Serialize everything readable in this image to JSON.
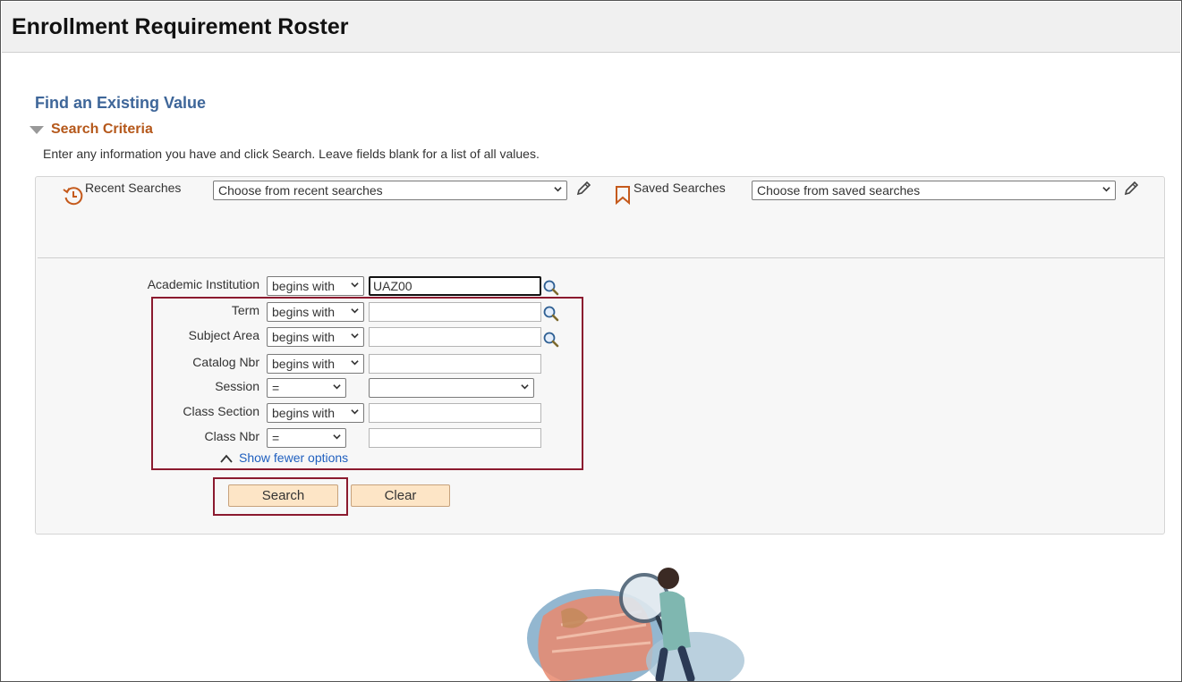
{
  "page": {
    "title": "Enrollment Requirement Roster"
  },
  "find": {
    "heading": "Find an Existing Value",
    "criteria_title": "Search Criteria",
    "instructions": "Enter any information you have and click Search. Leave fields blank for a list of all values."
  },
  "recent": {
    "label": "Recent Searches",
    "placeholder": "Choose from recent searches"
  },
  "saved": {
    "label": "Saved Searches",
    "placeholder": "Choose from saved searches"
  },
  "fields": {
    "academic_institution": {
      "label": "Academic Institution",
      "operator": "begins with",
      "value": "UAZ00"
    },
    "term": {
      "label": "Term",
      "operator": "begins with",
      "value": ""
    },
    "subject_area": {
      "label": "Subject Area",
      "operator": "begins with",
      "value": ""
    },
    "catalog_nbr": {
      "label": "Catalog Nbr",
      "operator": "begins with",
      "value": ""
    },
    "session": {
      "label": "Session",
      "operator": "=",
      "value": ""
    },
    "class_section": {
      "label": "Class Section",
      "operator": "begins with",
      "value": ""
    },
    "class_nbr": {
      "label": "Class Nbr",
      "operator": "=",
      "value": ""
    }
  },
  "show_fewer": "Show fewer options",
  "buttons": {
    "search": "Search",
    "clear": "Clear"
  },
  "colors": {
    "heading_blue": "#3e6699",
    "criteria_orange": "#b5581b",
    "link_blue": "#1f5fbf",
    "button_fill": "#fde5c6",
    "highlight": "#8b1a2f"
  },
  "icons": {
    "history": "history-icon",
    "bookmark": "bookmark-icon",
    "edit": "pencil-icon",
    "lookup": "magnifier-icon",
    "collapse": "chevron-up-icon"
  }
}
